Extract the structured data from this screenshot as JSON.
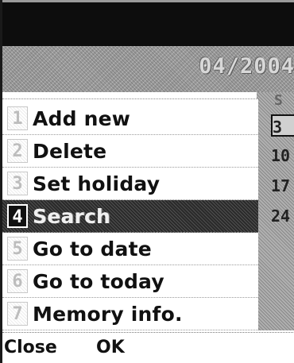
{
  "header": {
    "month_year": "04/2004"
  },
  "calendar": {
    "weekday": "S",
    "days": [
      "3",
      "10",
      "17",
      "24"
    ]
  },
  "menu": {
    "items": [
      {
        "num": "1",
        "label": "Add new"
      },
      {
        "num": "2",
        "label": "Delete"
      },
      {
        "num": "3",
        "label": "Set holiday"
      },
      {
        "num": "4",
        "label": "Search"
      },
      {
        "num": "5",
        "label": "Go to date"
      },
      {
        "num": "6",
        "label": "Go to today"
      },
      {
        "num": "7",
        "label": "Memory info."
      }
    ],
    "selected_index": 3
  },
  "softkeys": {
    "left": "Close",
    "center": "OK"
  }
}
